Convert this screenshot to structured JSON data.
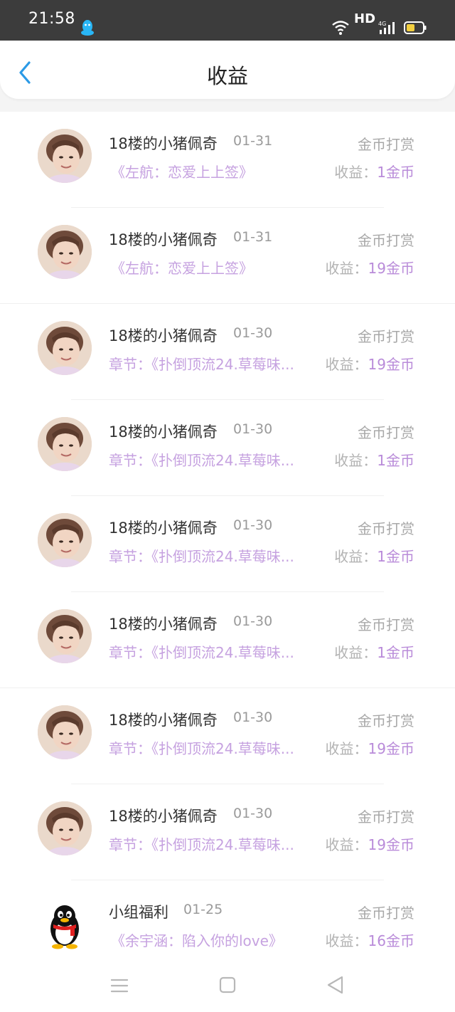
{
  "status_bar": {
    "time": "21:58",
    "hd_label": "HD",
    "network_label": "4G",
    "icons": [
      "qq-notification-icon",
      "wifi-icon",
      "signal-icon",
      "battery-icon"
    ]
  },
  "header": {
    "title": "收益",
    "back_icon": "chevron-left-icon"
  },
  "colors": {
    "accent_blue": "#2b9ae6",
    "purple_text": "#c6a2e0",
    "purple_value": "#b98bd9",
    "status_bar_bg": "#3c3c3c",
    "battery_fill": "#f2cf3f"
  },
  "items": [
    {
      "name": "18楼的小猪佩奇",
      "date": "01-31",
      "type": "金币打赏",
      "work": "《左航：恋爱上上签》",
      "income_label": "收益：",
      "income_value": "1金币",
      "avatar": "photo-avatar"
    },
    {
      "name": "18楼的小猪佩奇",
      "date": "01-31",
      "type": "金币打赏",
      "work": "《左航：恋爱上上签》",
      "income_label": "收益：",
      "income_value": "19金币",
      "avatar": "photo-avatar"
    },
    {
      "name": "18楼的小猪佩奇",
      "date": "01-30",
      "type": "金币打赏",
      "work": "章节：《扑倒顶流24.草莓味...",
      "income_label": "收益：",
      "income_value": "19金币",
      "avatar": "photo-avatar"
    },
    {
      "name": "18楼的小猪佩奇",
      "date": "01-30",
      "type": "金币打赏",
      "work": "章节：《扑倒顶流24.草莓味...",
      "income_label": "收益：",
      "income_value": "1金币",
      "avatar": "photo-avatar"
    },
    {
      "name": "18楼的小猪佩奇",
      "date": "01-30",
      "type": "金币打赏",
      "work": "章节：《扑倒顶流24.草莓味...",
      "income_label": "收益：",
      "income_value": "1金币",
      "avatar": "photo-avatar"
    },
    {
      "name": "18楼的小猪佩奇",
      "date": "01-30",
      "type": "金币打赏",
      "work": "章节：《扑倒顶流24.草莓味...",
      "income_label": "收益：",
      "income_value": "1金币",
      "avatar": "photo-avatar"
    },
    {
      "name": "18楼的小猪佩奇",
      "date": "01-30",
      "type": "金币打赏",
      "work": "章节：《扑倒顶流24.草莓味...",
      "income_label": "收益：",
      "income_value": "19金币",
      "avatar": "photo-avatar"
    },
    {
      "name": "18楼的小猪佩奇",
      "date": "01-30",
      "type": "金币打赏",
      "work": "章节：《扑倒顶流24.草莓味...",
      "income_label": "收益：",
      "income_value": "19金币",
      "avatar": "photo-avatar"
    },
    {
      "name": "小组福利",
      "date": "01-25",
      "type": "金币打赏",
      "work": "《余宇涵：陷入你的love》",
      "income_label": "收益：",
      "income_value": "16金币",
      "avatar": "qq-penguin-avatar"
    }
  ],
  "nav_bar": {
    "icons": [
      "menu-icon",
      "home-square-icon",
      "back-triangle-icon"
    ]
  }
}
